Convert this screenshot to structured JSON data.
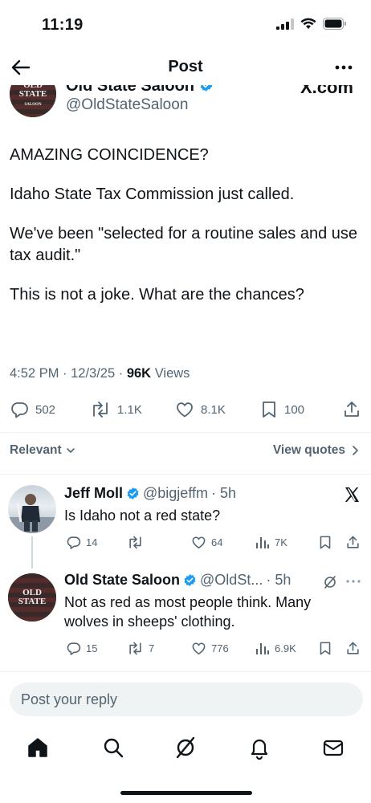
{
  "status_bar": {
    "time": "11:19"
  },
  "nav": {
    "title": "Post"
  },
  "post": {
    "author_name_partial": "Old State Saloon",
    "author_handle": "@OldStateSaloon",
    "source_partial": "X.com",
    "avatar_logo": "OLD STATE",
    "avatar_logo_sub": "SALOON",
    "body": [
      "AMAZING COINCIDENCE?",
      "Idaho State Tax Commission just called.",
      "We've been  \"selected for a routine sales and use tax audit.\"",
      "This is not a joke.  What are the chances?"
    ],
    "timestamp": "4:52 PM · 12/3/25 · ",
    "views_count": "96K",
    "views_label": " Views",
    "stats": {
      "replies": "502",
      "reposts": "1.1K",
      "likes": "8.1K",
      "bookmarks": "100"
    }
  },
  "filter": {
    "sort_label": "Relevant",
    "view_quotes": "View quotes"
  },
  "replies": [
    {
      "name": "Jeff Moll",
      "handle": "@bigjeffm",
      "time": "· 5h",
      "text": "Is Idaho not a red state?",
      "stats": {
        "replies": "14",
        "reposts": "",
        "likes": "64",
        "views": "7K"
      }
    },
    {
      "name": "Old State Saloon",
      "handle": "@OldSt...",
      "time": "· 5h",
      "text": "Not as red as most people think.  Many wolves in sheeps' clothing.",
      "avatar_logo": "OLD STATE",
      "stats": {
        "replies": "15",
        "reposts": "7",
        "likes": "776",
        "views": "6.9K"
      }
    }
  ],
  "compose": {
    "placeholder": "Post your reply"
  },
  "colors": {
    "verified": "#1d9bf0",
    "text": "#0f1419",
    "secondary": "#536471"
  },
  "icons": [
    "back-arrow-icon",
    "more-icon",
    "verified-icon",
    "reply-icon",
    "repost-icon",
    "like-icon",
    "bookmark-icon",
    "share-icon",
    "views-icon",
    "grok-icon",
    "x-logo-icon",
    "home-icon",
    "search-icon",
    "notifications-icon",
    "messages-icon"
  ]
}
